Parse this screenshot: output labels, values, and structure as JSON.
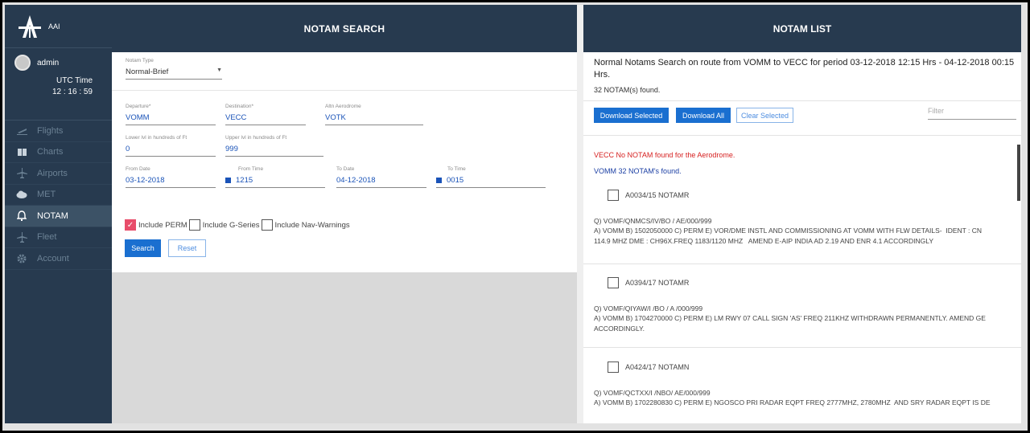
{
  "sidebar": {
    "org": "AAI",
    "user": "admin",
    "utc_label": "UTC Time",
    "utc_time": "12 : 16 : 59",
    "items": [
      {
        "label": "Flights",
        "icon": "flight-icon"
      },
      {
        "label": "Charts",
        "icon": "book-icon"
      },
      {
        "label": "Airports",
        "icon": "airplane-icon"
      },
      {
        "label": "MET",
        "icon": "cloud-icon"
      },
      {
        "label": "NOTAM",
        "icon": "bell-icon",
        "active": true
      },
      {
        "label": "Fleet",
        "icon": "airplane-icon"
      },
      {
        "label": "Account",
        "icon": "gear-icon"
      }
    ]
  },
  "search": {
    "title": "NOTAM SEARCH",
    "notam_type_label": "Notam Type",
    "notam_type_value": "Normal-Brief",
    "departure_label": "Departure*",
    "departure_value": "VOMM",
    "destination_label": "Destination*",
    "destination_value": "VECC",
    "altn_label": "Altn Aerodrome",
    "altn_value": "VOTK",
    "lower_label": "Lower lvl in hundreds of Ft",
    "lower_value": "0",
    "upper_label": "Upper lvl in hundreds of Ft",
    "upper_value": "999",
    "from_date_label": "From Date",
    "from_date_value": "03-12-2018",
    "from_time_label": "From Time",
    "from_time_value": "1215",
    "to_date_label": "To Date",
    "to_date_value": "04-12-2018",
    "to_time_label": "To Time",
    "to_time_value": "0015",
    "include_perm": "Include PERM",
    "include_g": "Include G-Series",
    "include_nav": "Include Nav-Warnings",
    "search_btn": "Search",
    "reset_btn": "Reset"
  },
  "list": {
    "title": "NOTAM LIST",
    "summary": "Normal Notams Search on route from VOMM to VECC for period 03-12-2018 12:15 Hrs - 04-12-2018 00:15 Hrs.",
    "count": "32 NOTAM(s) found.",
    "download_selected": "Download Selected",
    "download_all": "Download All",
    "clear_selected": "Clear Selected",
    "filter_placeholder": "Filter",
    "vecc_msg": "VECC No NOTAM found for the Aerodrome.",
    "vomm_msg": "VOMM 32 NOTAM's found.",
    "notams": [
      {
        "id": "A0034/15 NOTAMR",
        "q": "Q) VOMF/QNMCS/IV/BO / AE/000/999",
        "text": "A) VOMM B) 1502050000 C) PERM E) VOR/DME INSTL AND COMMISSIONING AT VOMM WITH FLW DETAILS-  IDENT : CN\n114.9 MHZ DME : CH96X.FREQ 1183/1120 MHZ   AMEND E-AIP INDIA AD 2.19 AND ENR 4.1 ACCORDINGLY"
      },
      {
        "id": "A0394/17 NOTAMR",
        "q": "Q) VOMF/QIYAW/I /BO / A /000/999",
        "text": "A) VOMM B) 1704270000 C) PERM E) LM RWY 07 CALL SIGN 'AS' FREQ 211KHZ WITHDRAWN PERMANENTLY. AMEND GE\nACCORDINGLY."
      },
      {
        "id": "A0424/17 NOTAMN",
        "q": "Q) VOMF/QCTXX/I /NBO/ AE/000/999",
        "text": "A) VOMM B) 1702280830 C) PERM E) NGOSCO PRI RADAR EQPT FREQ 2777MHZ, 2780MHZ  AND SRY RADAR EQPT IS DE"
      }
    ]
  }
}
